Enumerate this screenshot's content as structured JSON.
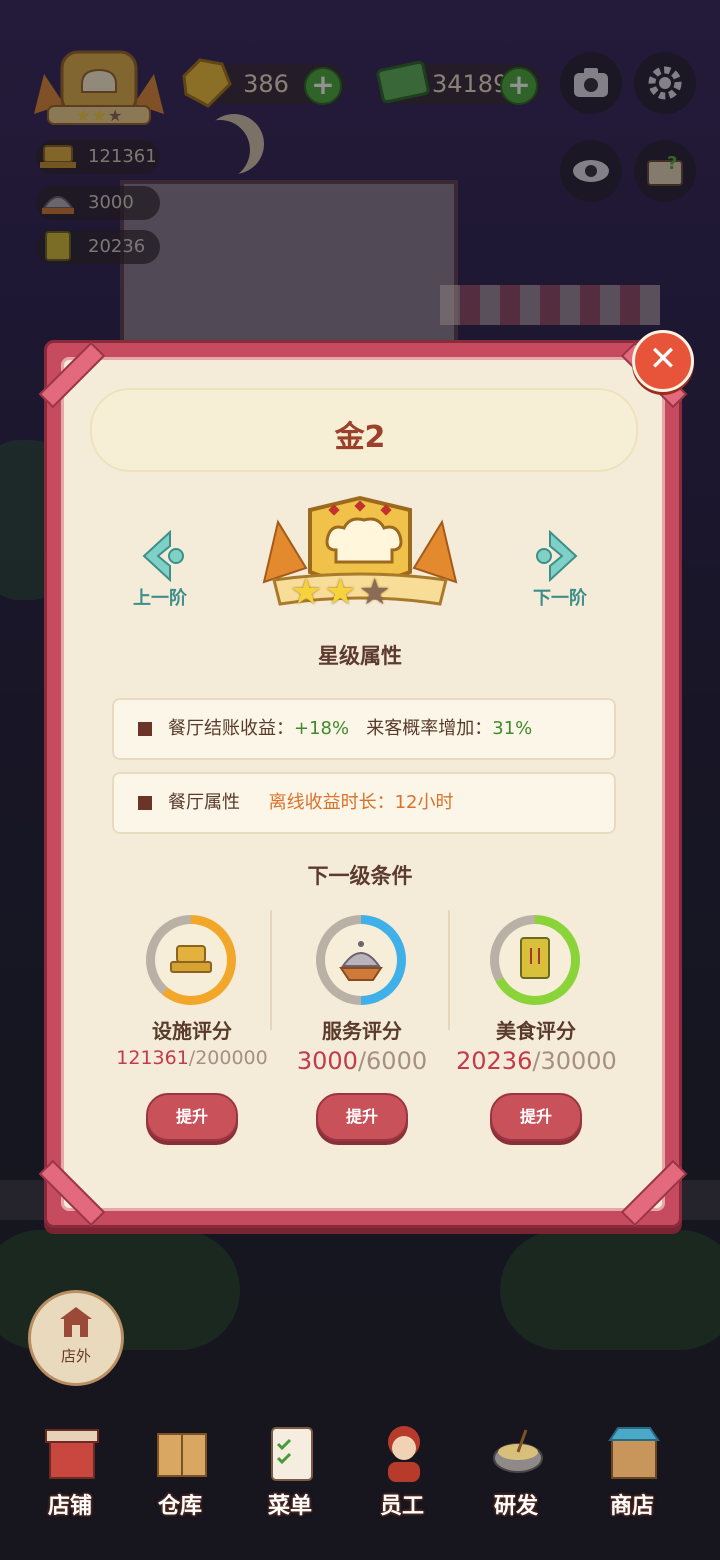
{
  "hud": {
    "gems": "386",
    "cash": "34189",
    "facility_score": "121361",
    "service_score": "3000",
    "food_score": "20236"
  },
  "modal": {
    "title": "金2",
    "prev_label": "上一阶",
    "next_label": "下一阶",
    "stars_filled": 2,
    "stars_total": 3,
    "star_attr_heading": "星级属性",
    "attributes": [
      {
        "label": "餐厅结账收益",
        "value1": "+18%",
        "label2": "来客概率增加",
        "value2": "31%"
      },
      {
        "label": "餐厅属性",
        "label2": "离线收益时长",
        "value2": "12小时"
      }
    ],
    "next_level_heading": "下一级条件",
    "requirements": [
      {
        "name": "设施评分",
        "current": "121361",
        "total": "/200000",
        "progress": 0.61,
        "color": "#f2a72a",
        "button": "提升"
      },
      {
        "name": "服务评分",
        "current": "3000",
        "total": "/6000",
        "progress": 0.5,
        "color": "#3fb0e8",
        "button": "提升"
      },
      {
        "name": "美食评分",
        "current": "20236",
        "total": "/30000",
        "progress": 0.67,
        "color": "#8ad43a",
        "button": "提升"
      }
    ]
  },
  "outdoor_label": "店外",
  "nav": [
    "店铺",
    "仓库",
    "菜单",
    "员工",
    "研发",
    "商店"
  ]
}
